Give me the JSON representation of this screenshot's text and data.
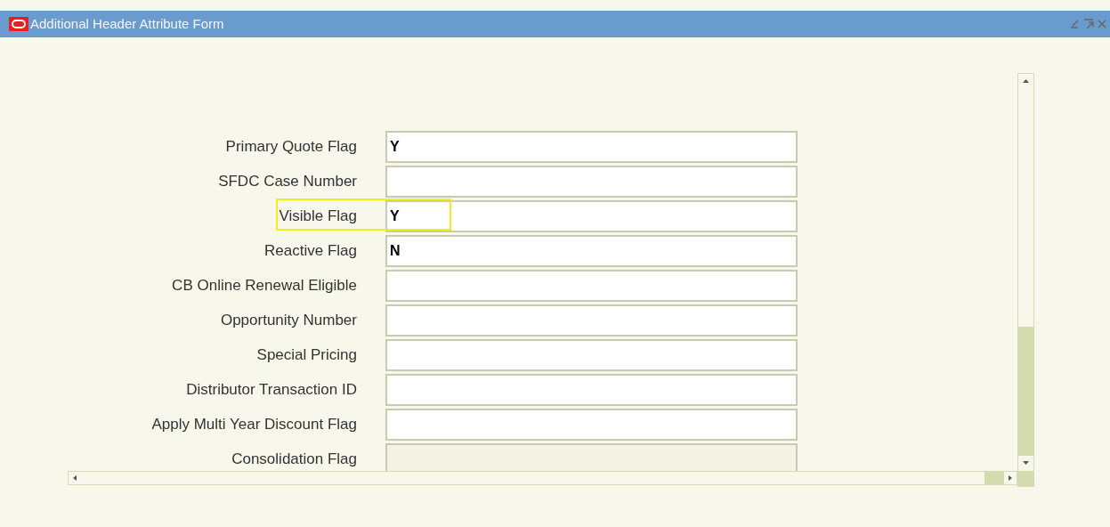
{
  "window": {
    "title": "Additional Header Attribute Form"
  },
  "fields": [
    {
      "label": "Primary Quote Flag",
      "value": "Y",
      "disabled": false,
      "highlighted": false
    },
    {
      "label": "SFDC Case Number",
      "disabled": false,
      "highlighted": false
    },
    {
      "label": "Visible Flag",
      "value": "Y",
      "disabled": false,
      "highlighted": true
    },
    {
      "label": "Reactive Flag",
      "value": "N",
      "disabled": false,
      "highlighted": false
    },
    {
      "label": "CB Online Renewal Eligible",
      "disabled": false,
      "highlighted": false
    },
    {
      "label": "Opportunity Number",
      "disabled": false,
      "highlighted": false
    },
    {
      "label": "Special Pricing",
      "disabled": false,
      "highlighted": false
    },
    {
      "label": "Distributor Transaction ID",
      "disabled": false,
      "highlighted": false
    },
    {
      "label": "Apply Multi Year Discount Flag",
      "disabled": false,
      "highlighted": false
    },
    {
      "label": "Consolidation Flag",
      "disabled": true,
      "highlighted": false
    }
  ]
}
